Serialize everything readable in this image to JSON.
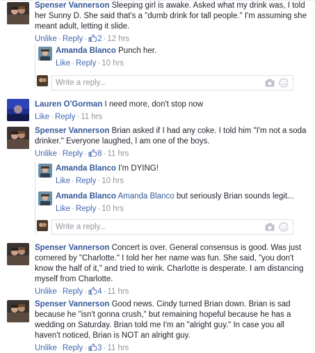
{
  "actions": {
    "unlike": "Unlike",
    "like": "Like",
    "reply": "Reply",
    "sep": "·",
    "write_placeholder": "Write a reply..."
  },
  "comments": [
    {
      "name": "Spenser Vannerson",
      "text": "Sleeping girl is awake. Asked what my drink was, I told her Sunny D. She said that's a \"dumb drink for tall people.\" I'm assuming she meant adult, letting it slide.",
      "likes": "2",
      "time": "12 hrs",
      "replies": [
        {
          "name": "Amanda Blanco",
          "text": "Punch her.",
          "time": "10 hrs"
        }
      ]
    },
    {
      "name": "Lauren O'Gorman",
      "text": "I need more, don't stop now",
      "time": "11 hrs"
    },
    {
      "name": "Spenser Vannerson",
      "text": "Brian asked if I had any coke. I told him \"I'm not a soda drinker.\" Everyone laughed, I am one of the boys.",
      "likes": "8",
      "time": "11 hrs",
      "replies": [
        {
          "name": "Amanda Blanco",
          "text": "I'm DYING!",
          "time": "10 hrs"
        },
        {
          "name": "Amanda Blanco",
          "tag": "Amanda Blanco",
          "text": "but seriously Brian sounds legit...",
          "time": "10 hrs"
        }
      ]
    },
    {
      "name": "Spenser Vannerson",
      "text": "Concert is over. General consensus is good. Was just cornered by \"Charlotte.\" I told her her name was fun. She said, \"you don't know the half of it,\" and tried to wink. Charlotte is desperate. I am distancing myself from Charlotte.",
      "likes": "4",
      "time": "11 hrs"
    },
    {
      "name": "Spenser Vannerson",
      "text": "Good news. Cindy turned Brian down. Brian is sad because he \"isn't gonna crush,\" but remaining hopeful because he has a wedding on Saturday. Brian told me I'm an \"alright guy.\" In case you all haven't noticed, Brian is NOT an alright guy.",
      "likes": "3",
      "time": "11 hrs"
    }
  ]
}
